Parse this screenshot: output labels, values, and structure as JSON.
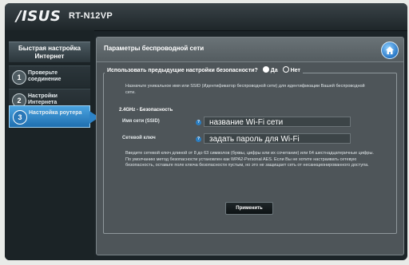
{
  "header": {
    "logo": "/ISUS",
    "model": "RT-N12VP"
  },
  "sidebar": {
    "title": "Быстрая настройка Интернет",
    "items": [
      {
        "step": "1",
        "label": "Проверьте соединение",
        "active": false
      },
      {
        "step": "2",
        "label": "Настройки Интернета",
        "active": false
      },
      {
        "step": "3",
        "label": "Настройка роутера",
        "active": true
      }
    ]
  },
  "panel": {
    "title": "Параметры беспроводной сети",
    "question": "Использовать предыдущие настройки безопасности?",
    "option_yes": "Да",
    "option_no": "Нет",
    "intro": "Назначьте уникальное имя или SSID (Идентификатор беспроводной сети) для идентификации Вашей беспроводной сети.",
    "section": "2.4GHz - Безопасность",
    "ssid_label": "Имя сети (SSID)",
    "ssid_value": "название Wi-Fi сети",
    "key_label": "Сетевой ключ",
    "key_value": "задать пароль для Wi-Fi",
    "help_mark": "?",
    "note": "Введите сетевой ключ длиной от 8 до 63 символов (буквы, цифры или их сочетание) или 64 шестнадцатеричные цифры. По умолчанию метод безопасности установлен как WPA2-Personal AES. Если Вы не хотите настраивать сетевую безопасность, оставьте поле ключа безопасности пустым, но это не защищает сеть от несанкционированного доступа.",
    "apply": "Применить"
  },
  "colors": {
    "accent": "#2a78c6",
    "background": "#1c2428",
    "panel": "#4e5559"
  }
}
